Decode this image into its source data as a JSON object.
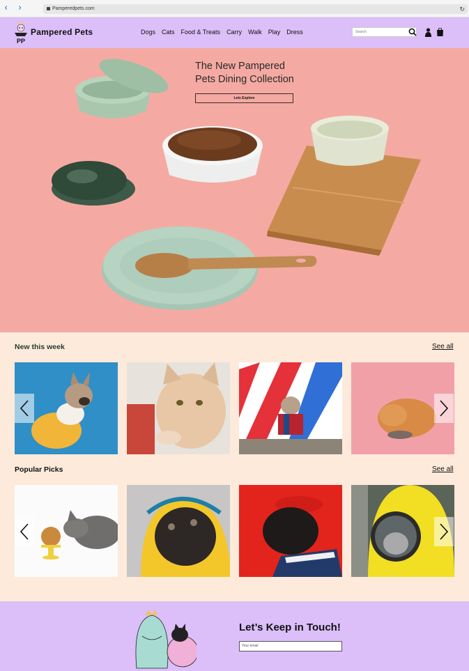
{
  "browser": {
    "back": "‹",
    "forward": "›",
    "url": "Pamperedpets.com",
    "reload": "↻"
  },
  "header": {
    "brand": "Pampered Pets",
    "logo_text": "PP",
    "menu": [
      "Dogs",
      "Cats",
      "Food & Treats",
      "Carry",
      "Walk",
      "Play",
      "Dress"
    ],
    "search_placeholder": "Search"
  },
  "hero": {
    "title_line1": "The New Pampered",
    "title_line2": "Pets Dining Collection",
    "button": "Lets Explore"
  },
  "new_this_week": {
    "title": "New this week",
    "see_all": "See all",
    "items": [
      "French bulldog in yellow hoodie",
      "Cream cat reaching for treat",
      "French bulldog in plaid jacket",
      "Orange cat eating from bowl"
    ]
  },
  "popular_picks": {
    "title": "Popular Picks",
    "see_all": "See all",
    "items": [
      "Grey cat sniffing treats",
      "Pug in yellow raincoat",
      "Pug in red beret",
      "Cat in yellow bubble backpack"
    ]
  },
  "footer": {
    "title": "Let’s Keep in Touch!",
    "email_placeholder": "Your email"
  },
  "colors": {
    "header_bg": "#dcbef9",
    "page_bg": "#fdeadb",
    "hero_bg": "#f4aaa2"
  }
}
